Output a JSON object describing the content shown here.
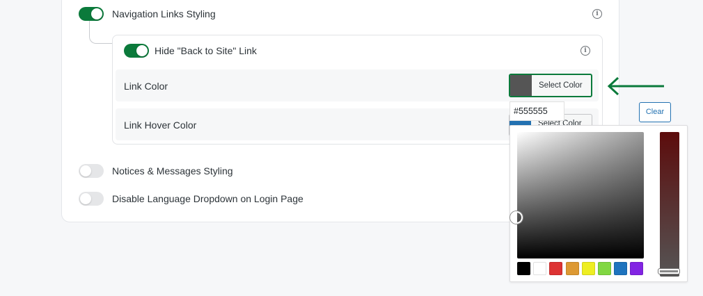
{
  "settings": {
    "nav_links": {
      "label": "Navigation Links Styling",
      "enabled": true
    },
    "hide_back": {
      "label": "Hide \"Back to Site\" Link",
      "enabled": true
    },
    "link_color": {
      "label": "Link Color",
      "button": "Select Color",
      "value": "#555555"
    },
    "link_hover": {
      "label": "Link Hover Color",
      "button": "Select Color",
      "value": "#2271b1"
    },
    "notices": {
      "label": "Notices & Messages Styling",
      "enabled": false
    },
    "disable_lang": {
      "label": "Disable Language Dropdown on Login Page",
      "enabled": false
    }
  },
  "picker": {
    "hex_value": "#555555",
    "clear_label": "Clear",
    "palette": [
      "#000000",
      "#ffffff",
      "#dd3333",
      "#dd9933",
      "#eeee22",
      "#81d742",
      "#1e73be",
      "#8224e3"
    ]
  },
  "colors": {
    "accent": "#0b7a3b",
    "link_blue": "#2271b1"
  },
  "icons": [
    "info-icon",
    "arrow-left-icon"
  ]
}
